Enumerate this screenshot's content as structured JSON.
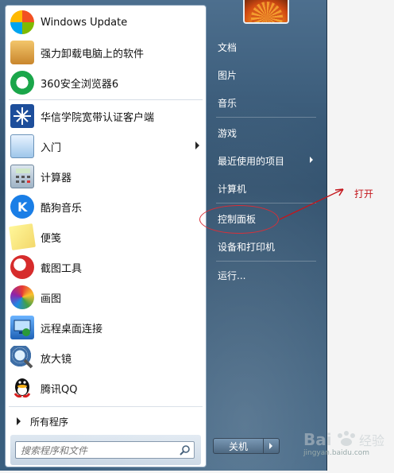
{
  "left_panel": {
    "items": [
      {
        "label": "Windows Update",
        "icon": "windows-update-icon",
        "has_submenu": false
      },
      {
        "label": "强力卸载电脑上的软件",
        "icon": "uninstaller-box-icon",
        "has_submenu": false
      },
      {
        "label": "360安全浏览器6",
        "icon": "360-browser-icon",
        "has_submenu": false
      },
      {
        "label": "华信学院宽带认证客户端",
        "icon": "broadband-client-icon",
        "has_submenu": false
      },
      {
        "label": "入门",
        "icon": "getting-started-icon",
        "has_submenu": true
      },
      {
        "label": "计算器",
        "icon": "calculator-icon",
        "has_submenu": false
      },
      {
        "label": "酷狗音乐",
        "icon": "kugou-music-icon",
        "has_submenu": false
      },
      {
        "label": "便笺",
        "icon": "sticky-notes-icon",
        "has_submenu": false
      },
      {
        "label": "截图工具",
        "icon": "snipping-tool-icon",
        "has_submenu": false
      },
      {
        "label": "画图",
        "icon": "paint-icon",
        "has_submenu": false
      },
      {
        "label": "远程桌面连接",
        "icon": "remote-desktop-icon",
        "has_submenu": false
      },
      {
        "label": "放大镜",
        "icon": "magnifier-icon",
        "has_submenu": false
      },
      {
        "label": "腾讯QQ",
        "icon": "qq-penguin-icon",
        "has_submenu": false
      }
    ],
    "all_programs": "所有程序",
    "search": {
      "placeholder": "搜索程序和文件"
    }
  },
  "right_panel": {
    "items": [
      {
        "label": "文档",
        "has_submenu": false
      },
      {
        "label": "图片",
        "has_submenu": false
      },
      {
        "label": "音乐",
        "has_submenu": false
      },
      {
        "label": "游戏",
        "has_submenu": false
      },
      {
        "label": "最近使用的项目",
        "has_submenu": true
      },
      {
        "label": "计算机",
        "has_submenu": false
      },
      {
        "label": "控制面板",
        "has_submenu": false,
        "highlighted": true
      },
      {
        "label": "设备和打印机",
        "has_submenu": false
      },
      {
        "label": "运行...",
        "has_submenu": false
      }
    ],
    "shutdown_label": "关机"
  },
  "annotation": {
    "text": "打开",
    "color": "#c4161c"
  },
  "watermark": {
    "line1": "Bai 经验",
    "line2": "jingyan.baidu.com"
  }
}
